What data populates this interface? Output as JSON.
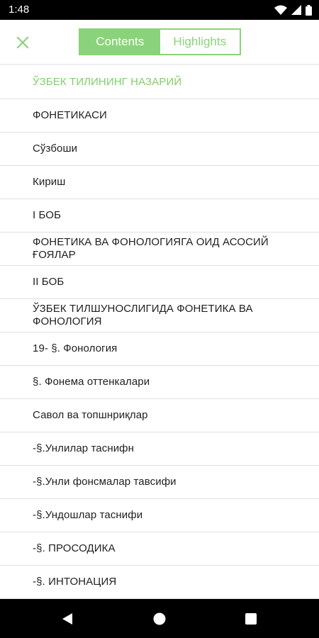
{
  "status_bar": {
    "time": "1:48",
    "icons": [
      "wifi-icon",
      "signal-icon",
      "battery-icon"
    ]
  },
  "header": {
    "close_icon": "close-icon",
    "tabs": [
      {
        "label": "Contents",
        "selected": true
      },
      {
        "label": "Highlights",
        "selected": false
      }
    ]
  },
  "toc": {
    "items": [
      {
        "label": "ЎЗБЕК ТИЛИНИНГ НАЗАРИЙ",
        "current": true
      },
      {
        "label": "ФОНЕТИКАСИ",
        "current": false
      },
      {
        "label": "Сўзбоши",
        "current": false
      },
      {
        "label": "Кириш",
        "current": false
      },
      {
        "label": "I БОБ",
        "current": false
      },
      {
        "label": "ФОНЕТИКА ВА ФОНОЛОГИЯГА ОИД АСОСИЙ ҒОЯЛАР",
        "current": false
      },
      {
        "label": "II БОБ",
        "current": false
      },
      {
        "label": "ЎЗБЕК ТИЛШУНОСЛИГИДА ФОНЕТИКА ВА ФОНОЛОГИЯ",
        "current": false
      },
      {
        "label": "19- §. Фонология",
        "current": false
      },
      {
        "label": "§. Фонема оттенкалари",
        "current": false
      },
      {
        "label": "Савол ва топшнриқлар",
        "current": false
      },
      {
        "label": "-§.Унлилар таснифн",
        "current": false
      },
      {
        "label": "-§.Унли фонсмалар тавсифи",
        "current": false
      },
      {
        "label": "-§.Ундошлар таснифи",
        "current": false
      },
      {
        "label": "-§. ПРОСОДИКА",
        "current": false
      },
      {
        "label": "-§. ИНТОНАЦИЯ",
        "current": false
      }
    ]
  },
  "colors": {
    "accent": "#8bd37a",
    "current_item": "#7fcf6b",
    "divider": "#e0e0e0",
    "system_bar": "#000000"
  },
  "nav_bar": {
    "buttons": [
      "back-icon",
      "home-icon",
      "recents-icon"
    ]
  }
}
